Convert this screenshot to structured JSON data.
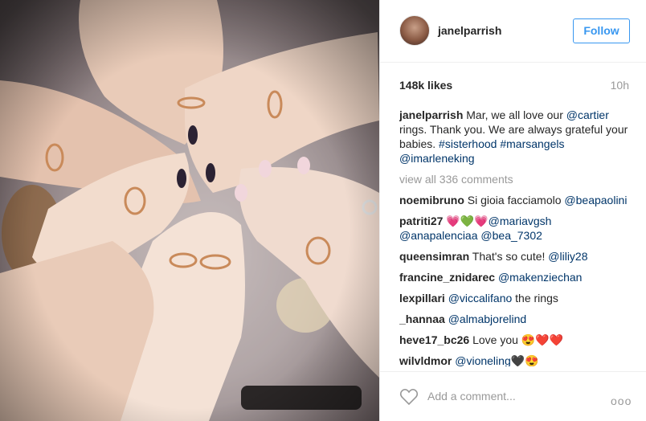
{
  "post": {
    "username": "janelparrish",
    "follow_label": "Follow",
    "likes": "148k likes",
    "time": "10h",
    "caption": {
      "user": "janelparrish",
      "text_1": "Mar, we all love our",
      "tag_1": "@cartier",
      "text_2": "rings. Thank you. We are always grateful your babies.",
      "tag_2": "#sisterhood",
      "tag_3": "#marsangels",
      "tag_4": "@imarleneking"
    },
    "view_all": "view all 336 comments",
    "comments": [
      {
        "user": "noemibruno",
        "text": "Si gioia facciamolo",
        "tag": "@beapaolini"
      },
      {
        "user": "patriti27",
        "emoji": "💗💚💗",
        "tag": "@mariavgsh",
        "tag_2": "@anapalenciaa",
        "tag_3": "@bea_7302"
      },
      {
        "user": "queensimran",
        "text": "That's so cute!",
        "tag": "@liliy28"
      },
      {
        "user": "francine_znidarec",
        "tag": "@makenziechan"
      },
      {
        "user": "lexpillari",
        "tag": "@viccalifano",
        "text": "the rings"
      },
      {
        "user": "_hannaa",
        "tag": "@almabjorelind"
      },
      {
        "user": "heve17_bc26",
        "text": "Love you",
        "emoji": "😍❤️❤️"
      },
      {
        "user": "wilvldmor",
        "tag": "@vioneling",
        "emoji": "🖤😍"
      }
    ],
    "add_comment_placeholder": "Add a comment...",
    "more_label": "ooo"
  },
  "icons": {
    "heart": "heart-icon",
    "more": "more-options-icon"
  },
  "colors": {
    "link": "#003569",
    "follow": "#3897f0",
    "muted": "#999999"
  }
}
